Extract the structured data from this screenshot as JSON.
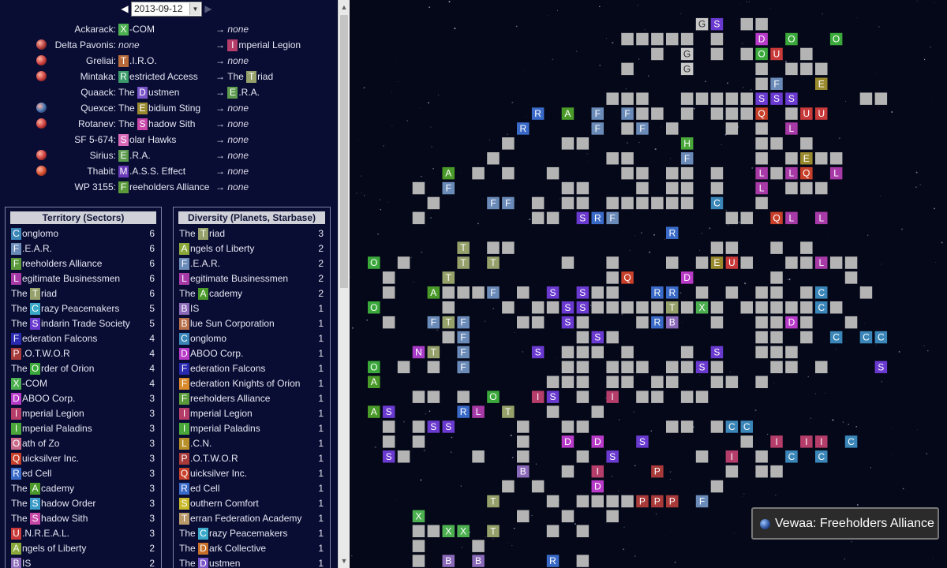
{
  "date": {
    "value": "2013-09-12",
    "prev_icon": "◀",
    "next_icon": "▶"
  },
  "systems": [
    {
      "name": "Ackarack:",
      "icon": null,
      "owner": {
        "prefix": "",
        "letter": "X",
        "rest": "-COM",
        "color": "#4caf50"
      },
      "target": null
    },
    {
      "name": "Delta Pavonis:",
      "icon": "#b13a3a",
      "owner": null,
      "target": {
        "prefix": "",
        "letter": "I",
        "rest": "mperial Legion",
        "color": "#b53d6a"
      }
    },
    {
      "name": "Greliai:",
      "icon": "#c83b3b",
      "owner": {
        "prefix": "",
        "letter": "T",
        "rest": ".I.R.O.",
        "color": "#b86b3a"
      },
      "target": null
    },
    {
      "name": "Mintaka:",
      "icon": "#c83b3b",
      "owner": {
        "prefix": "",
        "letter": "R",
        "rest": "estricted Access",
        "color": "#3a9a6a"
      },
      "target": {
        "prefix": "The ",
        "letter": "T",
        "rest": "riad",
        "color": "#95a06a"
      }
    },
    {
      "name": "Quaack:",
      "icon": null,
      "owner": {
        "prefix": "The ",
        "letter": "D",
        "rest": "ustmen",
        "color": "#7a55c8"
      },
      "target": {
        "prefix": "",
        "letter": "E",
        "rest": ".R.A.",
        "color": "#5c9a4e"
      }
    },
    {
      "name": "Quexce:",
      "icon": "#3a6fb0",
      "owner": {
        "prefix": "The ",
        "letter": "E",
        "rest": "bidium Sting",
        "color": "#9a8a2e"
      },
      "target": null
    },
    {
      "name": "Rotanev:",
      "icon": "#c83b3b",
      "owner": {
        "prefix": "The ",
        "letter": "S",
        "rest": "hadow Sith",
        "color": "#c846a8"
      },
      "target": null
    },
    {
      "name": "SF 5-674:",
      "icon": null,
      "owner": {
        "prefix": "",
        "letter": "S",
        "rest": "olar Hawks",
        "color": "#d86ab8"
      },
      "target": null
    },
    {
      "name": "Sirius:",
      "icon": "#c83b3b",
      "owner": {
        "prefix": "",
        "letter": "E",
        "rest": ".R.A.",
        "color": "#5c9a4e"
      },
      "target": null
    },
    {
      "name": "Thabit:",
      "icon": "#d04a2a",
      "owner": {
        "prefix": "",
        "letter": "M",
        "rest": ".A.S.S. Effect",
        "color": "#6a3ab8"
      },
      "target": null
    },
    {
      "name": "WP 3155:",
      "icon": null,
      "owner": {
        "prefix": "",
        "letter": "F",
        "rest": "reeholders Alliance",
        "color": "#5a9a3a"
      },
      "target": null
    }
  ],
  "none_text": "none",
  "arrow_text": "→",
  "territory": {
    "title": "Territory (Sectors)",
    "rows": [
      {
        "prefix": "",
        "letter": "C",
        "rest": "onglomo",
        "color": "#3a86b8",
        "count": "6"
      },
      {
        "prefix": "",
        "letter": "F",
        "rest": ".E.A.R.",
        "color": "#6a8ab8",
        "count": "6"
      },
      {
        "prefix": "",
        "letter": "F",
        "rest": "reeholders Alliance",
        "color": "#5a9a3a",
        "count": "6"
      },
      {
        "prefix": "",
        "letter": "L",
        "rest": "egitimate Businessmen",
        "color": "#a83aa8",
        "count": "6"
      },
      {
        "prefix": "The ",
        "letter": "T",
        "rest": "riad",
        "color": "#95a06a",
        "count": "6"
      },
      {
        "prefix": "The ",
        "letter": "C",
        "rest": "razy Peacemakers",
        "color": "#3aa8c8",
        "count": "5"
      },
      {
        "prefix": "The ",
        "letter": "S",
        "rest": "indarin Trade Society",
        "color": "#6a3ad0",
        "count": "5"
      },
      {
        "prefix": "",
        "letter": "F",
        "rest": "ederation Falcons",
        "color": "#2a2ab0",
        "count": "4"
      },
      {
        "prefix": "",
        "letter": "P",
        "rest": ".O.T.W.O.R",
        "color": "#a83a3a",
        "count": "4"
      },
      {
        "prefix": "The ",
        "letter": "O",
        "rest": "rder of Orion",
        "color": "#3aa83a",
        "count": "4"
      },
      {
        "prefix": "",
        "letter": "X",
        "rest": "-COM",
        "color": "#4caf50",
        "count": "4"
      },
      {
        "prefix": "",
        "letter": "D",
        "rest": "ABOO Corp.",
        "color": "#b83ac8",
        "count": "3"
      },
      {
        "prefix": "",
        "letter": "I",
        "rest": "mperial Legion",
        "color": "#b53d6a",
        "count": "3"
      },
      {
        "prefix": "",
        "letter": "I",
        "rest": "mperial Paladins",
        "color": "#4aa83a",
        "count": "3"
      },
      {
        "prefix": "",
        "letter": "O",
        "rest": "ath of Zo",
        "color": "#c86a8a",
        "count": "3"
      },
      {
        "prefix": "",
        "letter": "Q",
        "rest": "uicksilver Inc.",
        "color": "#c8402a",
        "count": "3"
      },
      {
        "prefix": "",
        "letter": "R",
        "rest": "ed Cell",
        "color": "#3a6ac8",
        "count": "3"
      },
      {
        "prefix": "The ",
        "letter": "A",
        "rest": "cademy",
        "color": "#4a9a2a",
        "count": "3"
      },
      {
        "prefix": "The ",
        "letter": "S",
        "rest": "hadow Order",
        "color": "#3a9ac8",
        "count": "3"
      },
      {
        "prefix": "The ",
        "letter": "S",
        "rest": "hadow Sith",
        "color": "#c846a8",
        "count": "3"
      },
      {
        "prefix": "",
        "letter": "U",
        "rest": ".N.R.E.A.L.",
        "color": "#c83a3a",
        "count": "3"
      },
      {
        "prefix": "",
        "letter": "A",
        "rest": "ngels of Liberty",
        "color": "#8aa83a",
        "count": "2"
      },
      {
        "prefix": "",
        "letter": "B",
        "rest": "IS",
        "color": "#8a6ab8",
        "count": "2"
      }
    ]
  },
  "diversity": {
    "title": "Diversity (Planets, Starbase)",
    "rows": [
      {
        "prefix": "The ",
        "letter": "T",
        "rest": "riad",
        "color": "#95a06a",
        "count": "3"
      },
      {
        "prefix": "",
        "letter": "A",
        "rest": "ngels of Liberty",
        "color": "#8aa83a",
        "count": "2"
      },
      {
        "prefix": "",
        "letter": "F",
        "rest": ".E.A.R.",
        "color": "#6a8ab8",
        "count": "2"
      },
      {
        "prefix": "",
        "letter": "L",
        "rest": "egitimate Businessmen",
        "color": "#a83aa8",
        "count": "2"
      },
      {
        "prefix": "The ",
        "letter": "A",
        "rest": "cademy",
        "color": "#4a9a2a",
        "count": "2"
      },
      {
        "prefix": "",
        "letter": "B",
        "rest": "IS",
        "color": "#8a6ab8",
        "count": "1"
      },
      {
        "prefix": "",
        "letter": "B",
        "rest": "lue Sun Corporation",
        "color": "#b8704a",
        "count": "1"
      },
      {
        "prefix": "",
        "letter": "C",
        "rest": "onglomo",
        "color": "#3a86b8",
        "count": "1"
      },
      {
        "prefix": "",
        "letter": "D",
        "rest": "ABOO Corp.",
        "color": "#b83ac8",
        "count": "1"
      },
      {
        "prefix": "",
        "letter": "F",
        "rest": "ederation Falcons",
        "color": "#2a2ab0",
        "count": "1"
      },
      {
        "prefix": "",
        "letter": "F",
        "rest": "ederation Knights of Orion",
        "color": "#d88a2a",
        "count": "1"
      },
      {
        "prefix": "",
        "letter": "F",
        "rest": "reeholders Alliance",
        "color": "#5a9a3a",
        "count": "1"
      },
      {
        "prefix": "",
        "letter": "I",
        "rest": "mperial Legion",
        "color": "#b53d6a",
        "count": "1"
      },
      {
        "prefix": "",
        "letter": "I",
        "rest": "mperial Paladins",
        "color": "#4aa83a",
        "count": "1"
      },
      {
        "prefix": "",
        "letter": "L",
        "rest": ".C.N.",
        "color": "#b8902a",
        "count": "1"
      },
      {
        "prefix": "",
        "letter": "P",
        "rest": ".O.T.W.O.R",
        "color": "#a83a3a",
        "count": "1"
      },
      {
        "prefix": "",
        "letter": "Q",
        "rest": "uicksilver Inc.",
        "color": "#c8402a",
        "count": "1"
      },
      {
        "prefix": "",
        "letter": "R",
        "rest": "ed Cell",
        "color": "#3a6ac8",
        "count": "1"
      },
      {
        "prefix": "",
        "letter": "S",
        "rest": "outhern Comfort",
        "color": "#c8b82a",
        "count": "1"
      },
      {
        "prefix": "",
        "letter": "T",
        "rest": "erran Federation Academy",
        "color": "#b89a6a",
        "count": "1"
      },
      {
        "prefix": "The ",
        "letter": "C",
        "rest": "razy Peacemakers",
        "color": "#3aa8c8",
        "count": "1"
      },
      {
        "prefix": "The ",
        "letter": "D",
        "rest": "ark Collective",
        "color": "#c8702a",
        "count": "1"
      },
      {
        "prefix": "The ",
        "letter": "D",
        "rest": "ustmen",
        "color": "#7a55c8",
        "count": "1"
      }
    ]
  },
  "tooltip": {
    "text": "Vewaa: Freeholders Alliance",
    "icon": "planet-icon"
  },
  "map": {
    "empty_color": "#b4b4b4",
    "cells": [
      "....................................................",
      "......................GS.##.........................",
      ".................#####.#..D.O..O....................",
      "...................#.G.#.#OU.#......................",
      ".................#...G....#.###.....................",
      "..........................#F..E.....................",
      "................###..#####SSS....##.................",
      "...........R.A.F.F##.#.###Q.#UU.....................",
      "..........R....F.#F.#...#.#.L.......................",
      ".........#...##......H....##.#......................",
      "........#.......##...F....#.#E##....................",
      ".....A.#.#..#....##.##.#..L#LQ.L....................",
      "...#.F.......##...#.##.#..L.###.....................",
      "....#...FF.#.##.######.C..#.........................",
      "...#.......##.SRF.......##.QL.L.....................",
      "....................R..............................#",
      "......T.##.............##..#.#......................",
      "O.#...T.T....#..#...#.#EU#..##L##...................",
      ".#...T..........#Q...D.....#....#...................",
      ".#..A###F.#.S.S##..RR.#.#.##.#C..#..................",
      "O....#...#.##SS#####T#X#.#####C#....................",
      ".#..FTF...##.S#...#RB..#..##D#..#...................",
      ".....#F.......#S#.........##.#.C.CC.................",
      "...NT.F....S.###.#...#.S..###.......................",
      "O.#.#.F......##.###.##S#...##.#...S.................",
      "A...........###.##.##..##.#.........................",
      "...##.#.O..IS.#.I.##.##.............................",
      "AS....RL.T..#..#...................................",
      ".#.#SS....#..##.....##.#CC..........................",
      ".#.#......#..D.D..S......#.I.II.C...................",
      ".S#....#..#...#.S.....#.I.#.C.C.....................",
      "..........B..#.I...P....#.##........................",
      ".........#.#...D.......#............................",
      "........T...#.####PPP.F.............................",
      "...X......#..#..#...................................",
      "...##XX.T...#.#.....................................",
      "...#...#............................................",
      "...#.B.B....R.#....................................."
    ]
  }
}
